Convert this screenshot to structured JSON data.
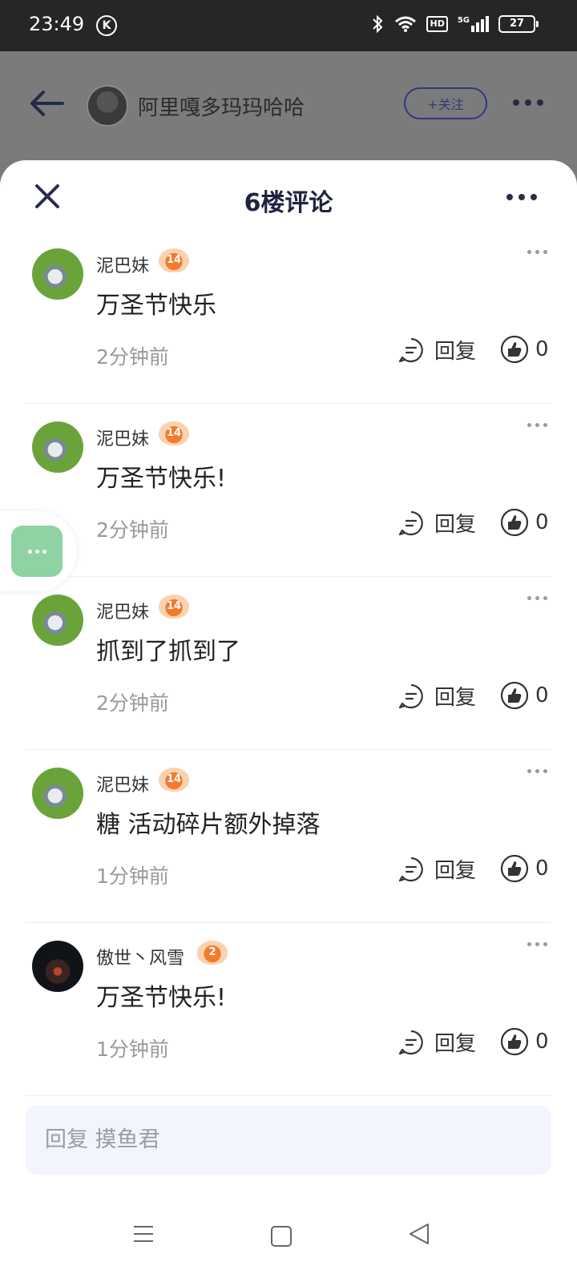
{
  "status_bar": {
    "time": "23:49",
    "k_icon": "K",
    "hd": "HD",
    "signal": "5G",
    "battery": "27"
  },
  "post_header": {
    "author": "阿里嘎多玛玛哈哈",
    "follow_label": "+关注"
  },
  "sheet": {
    "title": "6楼评论"
  },
  "comments": [
    {
      "user": "泥巴妹",
      "level": "14",
      "text": "万圣节快乐",
      "time": "2分钟前",
      "reply_label": "回复",
      "likes": "0",
      "avatar": "frog"
    },
    {
      "user": "泥巴妹",
      "level": "14",
      "text": "万圣节快乐!",
      "time": "2分钟前",
      "reply_label": "回复",
      "likes": "0",
      "avatar": "frog"
    },
    {
      "user": "泥巴妹",
      "level": "14",
      "text": "抓到了抓到了",
      "time": "2分钟前",
      "reply_label": "回复",
      "likes": "0",
      "avatar": "frog"
    },
    {
      "user": "泥巴妹",
      "level": "14",
      "text": "糖 活动碎片额外掉落",
      "time": "1分钟前",
      "reply_label": "回复",
      "likes": "0",
      "avatar": "frog"
    },
    {
      "user": "傲世丶风雪",
      "level": "2",
      "text": "万圣节快乐!",
      "time": "1分钟前",
      "reply_label": "回复",
      "likes": "0",
      "avatar": "dark"
    }
  ],
  "reply_input": {
    "placeholder": "回复 摸鱼君"
  },
  "colors": {
    "accent": "#303a7a",
    "badge": "#f47a2c",
    "bubble": "#8fd3a4"
  }
}
